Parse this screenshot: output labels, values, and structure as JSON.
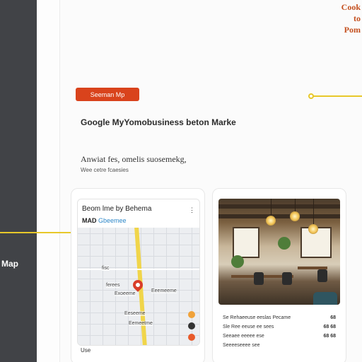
{
  "sidebar": {
    "map_label": "Map"
  },
  "top_right": {
    "line1": "Cook",
    "line2": "to",
    "line3": "Pom"
  },
  "cta": {
    "label": "Seeman Mp"
  },
  "main": {
    "heading": "Google MyYomobusiness beton Marke",
    "subheading": "Anwiat fes, omelis suosemekg,",
    "caption": "Wee cetre fcaesies"
  },
  "map_card": {
    "title": "Beom lme by Behema",
    "subtitle_prefix": "MAD",
    "subtitle_link": "Gbeemee",
    "share": "⋮",
    "labels": [
      "fisc",
      "ferees",
      "Exoeeme",
      "Eeemeeme",
      "Eeseeme",
      "Eemeetme"
    ],
    "bottom_label": "Use"
  },
  "photo_card": {
    "rows": [
      {
        "label": "Se Rehaeeuse eeslas Pecame",
        "value": "68"
      },
      {
        "label": "Sle Ree eeuse ee sees",
        "value": "68 68"
      },
      {
        "label": "Seeaee eeeee ese",
        "value": "68 68"
      },
      {
        "label": "Seeeeseeee see",
        "value": ""
      }
    ]
  },
  "colors": {
    "accent": "#d9431c",
    "highlight": "#e8c82a",
    "sidebar": "#414347"
  }
}
